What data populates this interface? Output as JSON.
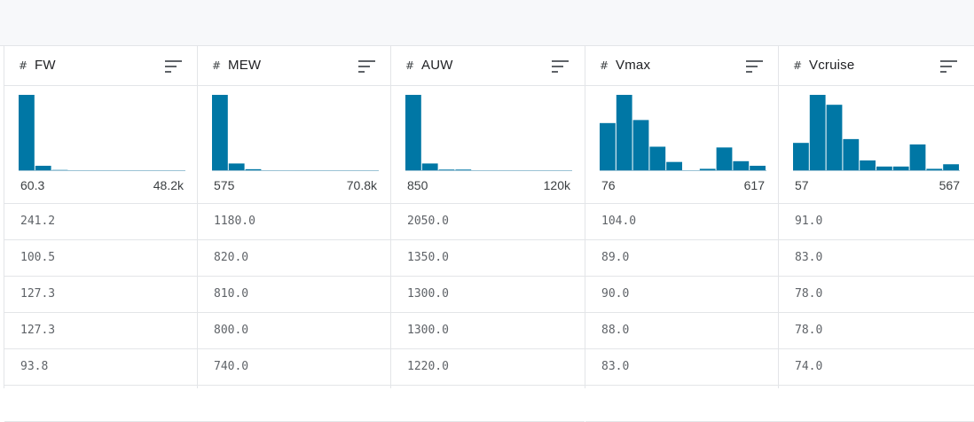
{
  "colors": {
    "bar": "#0077a5",
    "bar_light": "#9cc3d5",
    "grid_line": "#e3e5e8",
    "text": "#202124",
    "muted": "#5f6368"
  },
  "type_icon_glyph": "#",
  "columns": [
    {
      "name": "FW",
      "type_icon": "numeric-hash-icon",
      "hist_min": "60.3",
      "hist_max": "48.2k",
      "hist_bins": [
        1.0,
        0.07,
        0.015,
        0.004,
        0.0,
        0.004,
        0.004,
        0.004,
        0.004,
        0.004
      ],
      "cells": [
        "241.2",
        "100.5",
        "127.3",
        "127.3",
        "93.8",
        ""
      ]
    },
    {
      "name": "MEW",
      "type_icon": "numeric-hash-icon",
      "hist_min": "575",
      "hist_max": "70.8k",
      "hist_bins": [
        1.0,
        0.1,
        0.025,
        0.012,
        0.0,
        0.012,
        0.004,
        0.004,
        0.004,
        0.004
      ],
      "cells": [
        "1180.0",
        "820.0",
        "810.0",
        "800.0",
        "740.0",
        ""
      ]
    },
    {
      "name": "AUW",
      "type_icon": "numeric-hash-icon",
      "hist_min": "850",
      "hist_max": "120k",
      "hist_bins": [
        1.0,
        0.1,
        0.02,
        0.02,
        0.004,
        0.004,
        0.004,
        0.004,
        0.004,
        0.004
      ],
      "cells": [
        "2050.0",
        "1350.0",
        "1300.0",
        "1300.0",
        "1220.0",
        ""
      ]
    },
    {
      "name": "Vmax",
      "type_icon": "numeric-hash-icon",
      "hist_min": "76",
      "hist_max": "617",
      "hist_bins": [
        0.63,
        1.0,
        0.67,
        0.32,
        0.12,
        0.0,
        0.03,
        0.31,
        0.13,
        0.07
      ],
      "cells": [
        "104.0",
        "89.0",
        "90.0",
        "88.0",
        "83.0",
        ""
      ]
    },
    {
      "name": "Vcruise",
      "type_icon": "numeric-hash-icon",
      "hist_min": "57",
      "hist_max": "567",
      "hist_bins": [
        0.37,
        1.0,
        0.87,
        0.42,
        0.14,
        0.06,
        0.06,
        0.35,
        0.03,
        0.09
      ],
      "cells": [
        "91.0",
        "83.0",
        "78.0",
        "78.0",
        "74.0",
        ""
      ]
    }
  ]
}
